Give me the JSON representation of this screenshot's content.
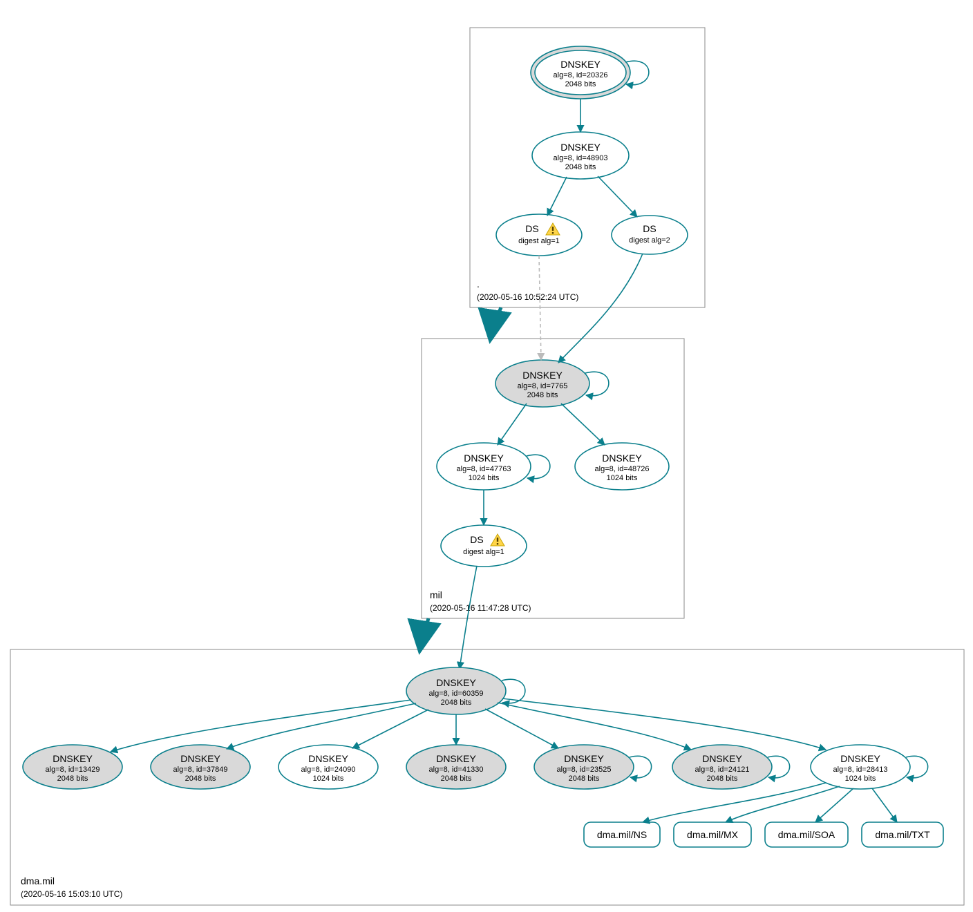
{
  "colors": {
    "stroke": "#0a7f8c",
    "node_fill_gray": "#d9d9d9",
    "box_stroke": "#888888"
  },
  "zones": {
    "root": {
      "name": ".",
      "timestamp": "(2020-05-16 10:52:24 UTC)"
    },
    "mil": {
      "name": "mil",
      "timestamp": "(2020-05-16 11:47:28 UTC)"
    },
    "dma": {
      "name": "dma.mil",
      "timestamp": "(2020-05-16 15:03:10 UTC)"
    }
  },
  "nodes": {
    "root_ksk": {
      "title": "DNSKEY",
      "line2": "alg=8, id=20326",
      "line3": "2048 bits"
    },
    "root_zsk": {
      "title": "DNSKEY",
      "line2": "alg=8, id=48903",
      "line3": "2048 bits"
    },
    "root_ds1": {
      "title": "DS",
      "line2": "digest alg=1",
      "warn": true
    },
    "root_ds2": {
      "title": "DS",
      "line2": "digest alg=2"
    },
    "mil_ksk": {
      "title": "DNSKEY",
      "line2": "alg=8, id=7765",
      "line3": "2048 bits"
    },
    "mil_zsk1": {
      "title": "DNSKEY",
      "line2": "alg=8, id=47763",
      "line3": "1024 bits"
    },
    "mil_zsk2": {
      "title": "DNSKEY",
      "line2": "alg=8, id=48726",
      "line3": "1024 bits"
    },
    "mil_ds1": {
      "title": "DS",
      "line2": "digest alg=1",
      "warn": true
    },
    "dma_ksk": {
      "title": "DNSKEY",
      "line2": "alg=8, id=60359",
      "line3": "2048 bits"
    },
    "dma_k1": {
      "title": "DNSKEY",
      "line2": "alg=8, id=13429",
      "line3": "2048 bits"
    },
    "dma_k2": {
      "title": "DNSKEY",
      "line2": "alg=8, id=37849",
      "line3": "2048 bits"
    },
    "dma_k3": {
      "title": "DNSKEY",
      "line2": "alg=8, id=24090",
      "line3": "1024 bits"
    },
    "dma_k4": {
      "title": "DNSKEY",
      "line2": "alg=8, id=41330",
      "line3": "2048 bits"
    },
    "dma_k5": {
      "title": "DNSKEY",
      "line2": "alg=8, id=23525",
      "line3": "2048 bits"
    },
    "dma_k6": {
      "title": "DNSKEY",
      "line2": "alg=8, id=24121",
      "line3": "2048 bits"
    },
    "dma_k7": {
      "title": "DNSKEY",
      "line2": "alg=8, id=28413",
      "line3": "1024 bits"
    }
  },
  "rrsets": {
    "ns": "dma.mil/NS",
    "mx": "dma.mil/MX",
    "soa": "dma.mil/SOA",
    "txt": "dma.mil/TXT"
  }
}
